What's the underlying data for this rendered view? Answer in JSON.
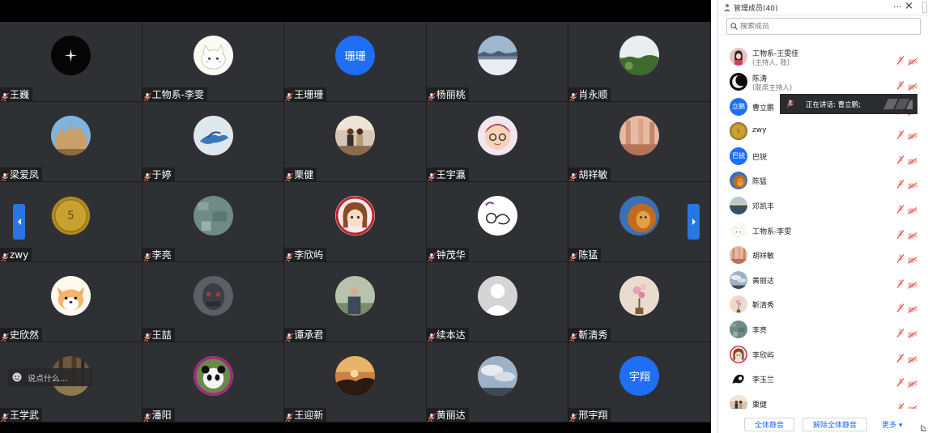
{
  "video_grid": {
    "participants": [
      {
        "name": "王巍",
        "avatar": "star-photo"
      },
      {
        "name": "工物系-李雯",
        "avatar": "cat-cartoon"
      },
      {
        "name": "王珊珊",
        "avatar_text": "珊珊"
      },
      {
        "name": "杨丽桃",
        "avatar": "snow-photo"
      },
      {
        "name": "肖永顺",
        "avatar": "landscape-photo"
      },
      {
        "name": "梁爱凤",
        "avatar": "castle-photo"
      },
      {
        "name": "于婷",
        "avatar": "bird-photo"
      },
      {
        "name": "栗健",
        "avatar": "couple-photo"
      },
      {
        "name": "王宇瀛",
        "avatar": "glasses-cartoon"
      },
      {
        "name": "胡祥敏",
        "avatar": "pink-photo"
      },
      {
        "name": "zwy",
        "avatar": "coin-photo"
      },
      {
        "name": "李亮",
        "avatar": "aerial-photo"
      },
      {
        "name": "李欣屿",
        "avatar": "girl-cartoon"
      },
      {
        "name": "钟茂华",
        "avatar": "sketch-drawing"
      },
      {
        "name": "陈猛",
        "avatar": "lion-photo"
      },
      {
        "name": "史欣然",
        "avatar": "dog-cartoon"
      },
      {
        "name": "王喆",
        "avatar": "mask-photo"
      },
      {
        "name": "谭承君",
        "avatar": "man-photo"
      },
      {
        "name": "续本达",
        "avatar": "default-person"
      },
      {
        "name": "靳清秀",
        "avatar": "flowers-photo"
      },
      {
        "name": "王学武",
        "avatar": "forest-photo"
      },
      {
        "name": "潘阳",
        "avatar": "panda-photo"
      },
      {
        "name": "王迎新",
        "avatar": "sunset-photo"
      },
      {
        "name": "黄丽达",
        "avatar": "sky-photo"
      },
      {
        "name": "邢宇翔",
        "avatar_text": "宇翔"
      }
    ],
    "chat_placeholder": "说点什么..."
  },
  "panel": {
    "title": "管理成员(40)",
    "more": "···",
    "close": "×",
    "search_placeholder": "搜索成员",
    "speaker_tip": "正在讲话: 曹立鹏;",
    "members": [
      {
        "name": "工物系-王雯佳",
        "role": "(主持人, 我)",
        "avatar": "woman-photo"
      },
      {
        "name": "陈涛",
        "role": "(联席主持人)",
        "avatar": "moon-photo"
      },
      {
        "name": "曹立鹏",
        "avatar_text": "立鹏"
      },
      {
        "name": "zwy",
        "avatar": "coin-photo"
      },
      {
        "name": "巴锐",
        "avatar_text": "巴锐"
      },
      {
        "name": "陈猛",
        "avatar": "lion-photo"
      },
      {
        "name": "邓凯丰",
        "avatar": "sea-photo"
      },
      {
        "name": "工物系-李雯",
        "avatar": "cat-cartoon"
      },
      {
        "name": "胡祥敏",
        "avatar": "pink-photo"
      },
      {
        "name": "黄丽达",
        "avatar": "sky-photo"
      },
      {
        "name": "靳清秀",
        "avatar": "flowers-photo"
      },
      {
        "name": "李亮",
        "avatar": "aerial-photo"
      },
      {
        "name": "李欣屿",
        "avatar": "girl-cartoon"
      },
      {
        "name": "李玉兰",
        "avatar": "curl-drawing"
      },
      {
        "name": "栗健",
        "avatar": "couple-photo"
      }
    ],
    "footer": {
      "mute_all": "全体静音",
      "unmute_all": "解除全体静音",
      "more": "更多 ▾"
    }
  },
  "colors": {
    "accent_blue": "#1e6ff5",
    "tile_bg": "#2f3033",
    "mic_red": "#e0443a"
  }
}
